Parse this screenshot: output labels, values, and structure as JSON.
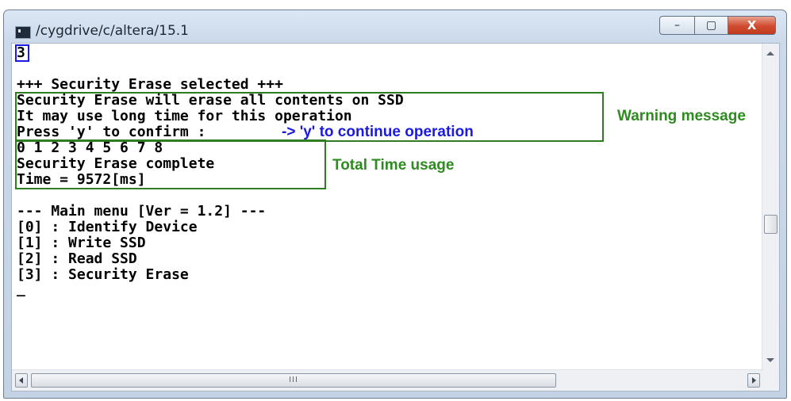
{
  "window": {
    "title": "/cygdrive/c/altera/15.1",
    "controls": {
      "minimize": "–",
      "maximize": "▢",
      "close": "X"
    }
  },
  "console": {
    "lines": [
      "3",
      "",
      "+++ Security Erase selected +++",
      "Security Erase will erase all contents on SSD",
      "It may use long time for this operation",
      "Press 'y' to confirm :",
      "0 1 2 3 4 5 6 7 8",
      "Security Erase complete",
      "Time = 9572[ms]",
      "",
      "--- Main menu [Ver = 1.2] ---",
      "[0] : Identify Device",
      "[1] : Write SSD",
      "[2] : Read SSD",
      "[3] : Security Erase",
      "_"
    ]
  },
  "annotations": {
    "confirm_hint": "-> 'y' to continue operation",
    "warning_label": "Warning message",
    "time_label": "Total Time usage"
  },
  "scrollbar": {
    "grip": "III"
  },
  "colors": {
    "annotation_blue": "#1a1ae0",
    "annotation_green": "#2e8b20"
  }
}
